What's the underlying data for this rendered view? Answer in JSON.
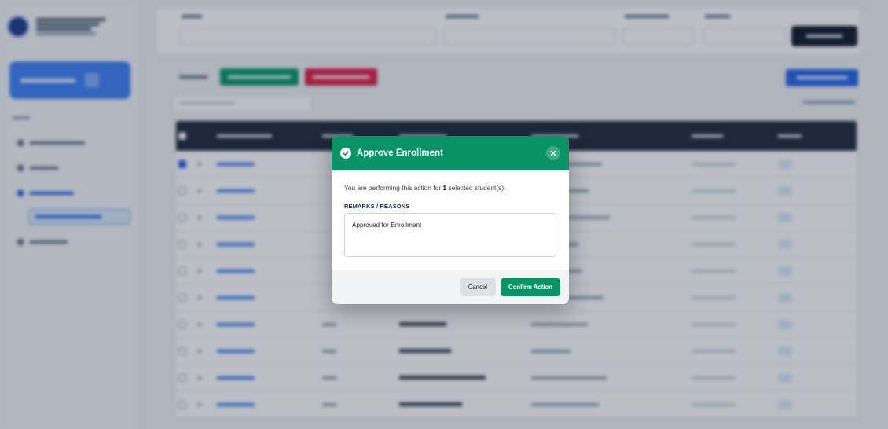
{
  "modal": {
    "title": "Approve Enrollment",
    "message_prefix": "You are performing this action for ",
    "selected_count": "1",
    "message_suffix": " selected student(s).",
    "remarks_label": "REMARKS / REASONS",
    "remarks_value": "Approved for Enrollment",
    "cancel_label": "Cancel",
    "confirm_label": "Confirm Action",
    "accent_color": "#0a9466"
  },
  "icons": {
    "header": "check-circle-icon",
    "close": "close-icon"
  }
}
